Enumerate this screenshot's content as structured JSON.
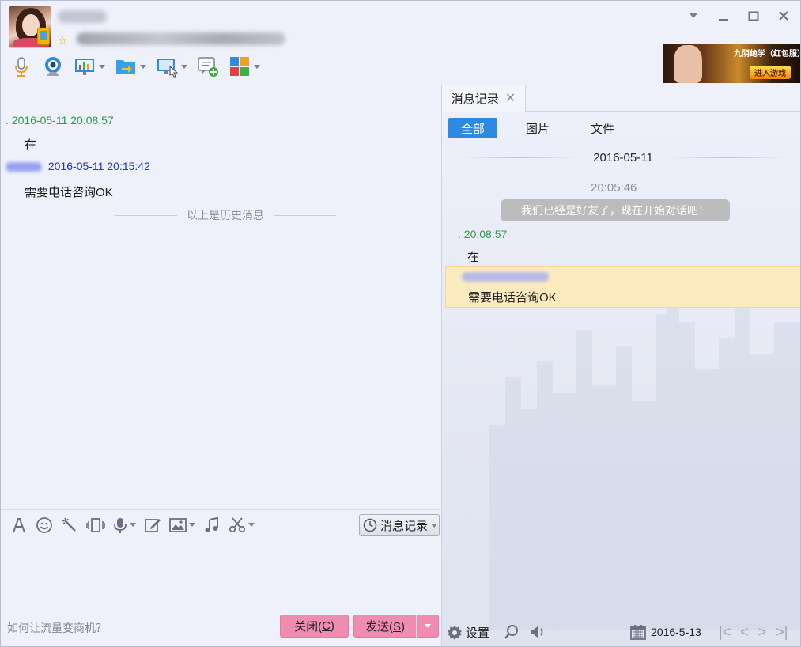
{
  "window": {
    "minimize": "—",
    "maximize": "☐",
    "close": "✕",
    "dropdown": "▼"
  },
  "toolbar": {
    "items": [
      "voice-call",
      "video-call",
      "screen-share",
      "file-transfer",
      "remote-assist",
      "new-discussion",
      "app-grid"
    ]
  },
  "ad": {
    "title": "九阴绝学（红包服）",
    "cta": "进入游戏"
  },
  "chat": {
    "messages": [
      {
        "time": ". 2016-05-11 20:08:57",
        "text": "在"
      },
      {
        "time": " 2016-05-11 20:15:42",
        "text": "需要电话咨询OK"
      }
    ],
    "history_divider": "以上是历史消息"
  },
  "input": {
    "history_button": "消息记录",
    "placeholder": ""
  },
  "bottom": {
    "promo": "如何让流量变商机？",
    "close_label": "关闭(",
    "close_key": "C",
    "close_tail": ")",
    "send_label": "发送(",
    "send_key": "S",
    "send_tail": ")"
  },
  "history_panel": {
    "tab_label": "消息记录",
    "filters": [
      "全部",
      "图片",
      "文件"
    ],
    "active_filter": 0,
    "date": "2016-05-11",
    "system_time": "20:05:46",
    "system_message": "我们已经是好友了，现在开始对话吧！",
    "messages": [
      {
        "time": ". 20:08:57",
        "text": "在"
      },
      {
        "time": "",
        "text": "需要电话咨询OK"
      }
    ],
    "settings_label": "设置",
    "calendar_date": "2016-5-13"
  },
  "colors": {
    "accent": "#2d8ae0",
    "send_button": "#f08cb0",
    "self_name": "#2f9a4a",
    "peer_name": "#2030d0",
    "highlight": "#fdebc0"
  }
}
